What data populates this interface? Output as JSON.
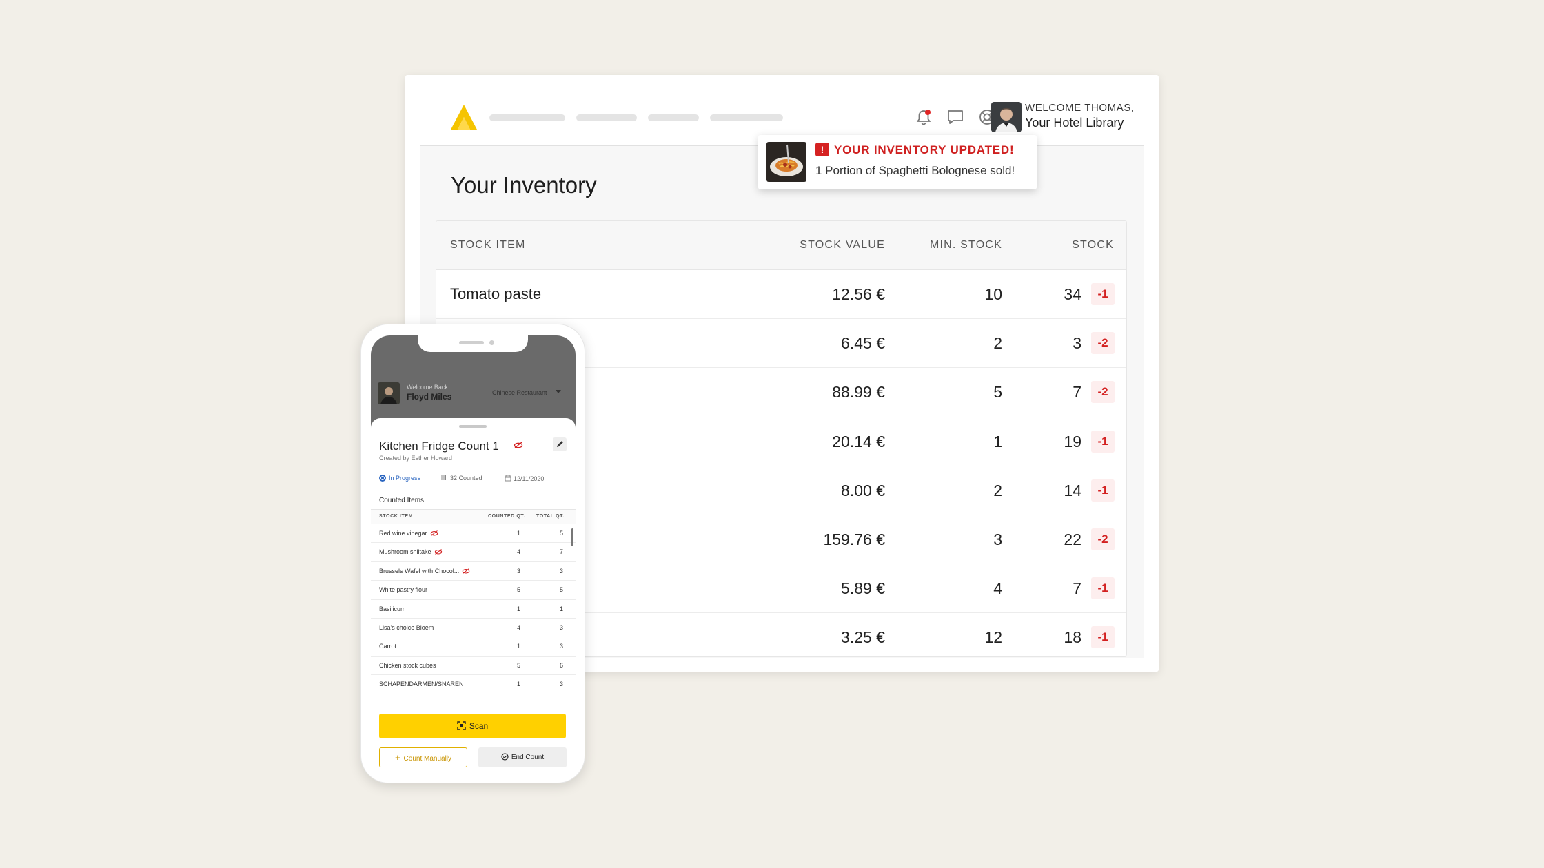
{
  "desktop": {
    "header": {
      "welcome": "WELCOME THOMAS,",
      "location": "Your Hotel Library",
      "icons": [
        "logo-icon",
        "bell-icon",
        "chat-icon",
        "help-icon"
      ]
    },
    "notification": {
      "title": "YOUR INVENTORY UPDATED!",
      "badge": "!",
      "message": "1 Portion of Spaghetti Bolognese sold!"
    },
    "title": "Your Inventory",
    "table": {
      "columns": [
        "STOCK ITEM",
        "STOCK VALUE",
        "MIN. STOCK",
        "STOCK"
      ],
      "rows": [
        {
          "name": "Tomato paste",
          "value": "12.56 €",
          "min": "10",
          "stock": "34",
          "delta": "-1"
        },
        {
          "name": "",
          "value": "6.45 €",
          "min": "2",
          "stock": "3",
          "delta": "-2"
        },
        {
          "name": "",
          "value": "88.99 €",
          "min": "5",
          "stock": "7",
          "delta": "-2"
        },
        {
          "name": "",
          "value": "20.14 €",
          "min": "1",
          "stock": "19",
          "delta": "-1"
        },
        {
          "name": "",
          "value": "8.00 €",
          "min": "2",
          "stock": "14",
          "delta": "-1"
        },
        {
          "name": "",
          "value": "159.76 €",
          "min": "3",
          "stock": "22",
          "delta": "-2"
        },
        {
          "name": "",
          "value": "5.89 €",
          "min": "4",
          "stock": "7",
          "delta": "-1"
        },
        {
          "name": "",
          "value": "3.25 €",
          "min": "12",
          "stock": "18",
          "delta": "-1"
        }
      ]
    }
  },
  "mobile": {
    "welcome": "Welcome Back",
    "user": "Floyd Miles",
    "restaurant": "Chinese Restaurant",
    "title": "Kitchen Fridge Count 1",
    "created_by": "Created by Esther Howard",
    "status": "In Progress",
    "counted": "32 Counted",
    "date": "12/11/2020",
    "section": "Counted Items",
    "columns": [
      "STOCK ITEM",
      "COUNTED QT.",
      "TOTAL QT."
    ],
    "rows": [
      {
        "name": "Red wine vinegar",
        "counted": "1",
        "total": "5",
        "flag": true
      },
      {
        "name": "Mushroom shiitake",
        "counted": "4",
        "total": "7",
        "flag": true
      },
      {
        "name": "Brussels Wafel with Chocol...",
        "counted": "3",
        "total": "3",
        "flag": true
      },
      {
        "name": "White pastry flour",
        "counted": "5",
        "total": "5",
        "flag": false
      },
      {
        "name": "Basilicum",
        "counted": "1",
        "total": "1",
        "flag": false
      },
      {
        "name": "Lisa's choice Bloem",
        "counted": "4",
        "total": "3",
        "flag": false
      },
      {
        "name": "Carrot",
        "counted": "1",
        "total": "3",
        "flag": false
      },
      {
        "name": "Chicken stock cubes",
        "counted": "5",
        "total": "6",
        "flag": false
      },
      {
        "name": "SCHAPENDARMEN/SNAREN",
        "counted": "1",
        "total": "3",
        "flag": false
      }
    ],
    "scan_label": "Scan",
    "count_manually_label": "Count Manually",
    "end_count_label": "End Count"
  },
  "colors": {
    "accent": "#ffd000",
    "alert": "#d32020",
    "info": "#2b66c0"
  }
}
